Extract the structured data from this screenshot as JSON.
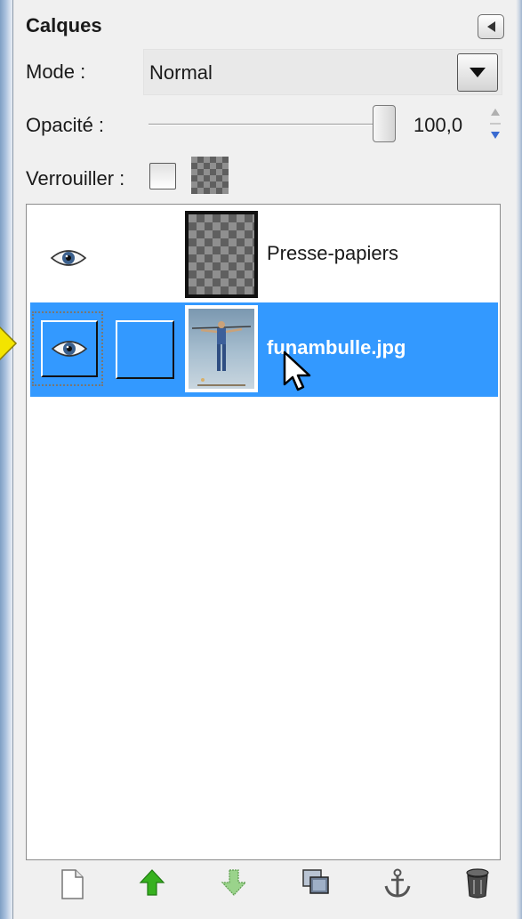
{
  "panel": {
    "title": "Calques",
    "mode_label": "Mode :",
    "mode_value": "Normal",
    "opacity_label": "Opacité :",
    "opacity_value": "100,0",
    "opacity_percent": 100,
    "lock_label": "Verrouiller :",
    "lock_pixels_checked": false
  },
  "layers": [
    {
      "name": "Presse-papiers",
      "visible": true,
      "selected": false,
      "thumbnail": "transparent-checker"
    },
    {
      "name": "funambulle.jpg",
      "visible": true,
      "selected": true,
      "thumbnail": "photo"
    }
  ],
  "toolbar": {
    "icons": [
      "new-layer-icon",
      "raise-layer-icon",
      "lower-layer-icon",
      "duplicate-layer-icon",
      "anchor-layer-icon",
      "delete-layer-icon"
    ]
  },
  "colors": {
    "selection": "#3399ff",
    "panel_bg": "#f0f0f0",
    "raise_green": "#37b11f"
  }
}
